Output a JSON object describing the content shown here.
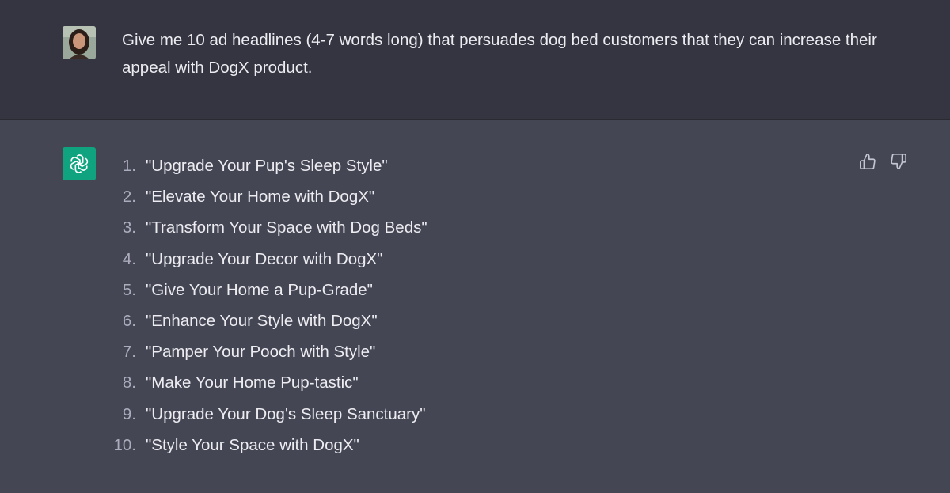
{
  "user_message": {
    "text": "Give me 10 ad headlines (4-7 words long) that persuades dog bed customers that they can increase their appeal with DogX product."
  },
  "assistant_message": {
    "items": [
      {
        "number": "1.",
        "text": "\"Upgrade Your Pup's Sleep Style\""
      },
      {
        "number": "2.",
        "text": "\"Elevate Your Home with DogX\""
      },
      {
        "number": "3.",
        "text": "\"Transform Your Space with Dog Beds\""
      },
      {
        "number": "4.",
        "text": "\"Upgrade Your Decor with DogX\""
      },
      {
        "number": "5.",
        "text": "\"Give Your Home a Pup-Grade\""
      },
      {
        "number": "6.",
        "text": "\"Enhance Your Style with DogX\""
      },
      {
        "number": "7.",
        "text": "\"Pamper Your Pooch with Style\""
      },
      {
        "number": "8.",
        "text": "\"Make Your Home Pup-tastic\""
      },
      {
        "number": "9.",
        "text": "\"Upgrade Your Dog's Sleep Sanctuary\""
      },
      {
        "number": "10.",
        "text": "\"Style Your Space with DogX\""
      }
    ]
  },
  "icons": {
    "user_avatar": "user-avatar-photo",
    "assistant_avatar": "openai-logo-icon",
    "thumbs_up": "thumbs-up-icon",
    "thumbs_down": "thumbs-down-icon"
  },
  "colors": {
    "user_bg": "#343541",
    "assistant_bg": "#444654",
    "text": "#ececf1",
    "muted": "#acacbe",
    "assistant_avatar_bg": "#10a37f"
  }
}
